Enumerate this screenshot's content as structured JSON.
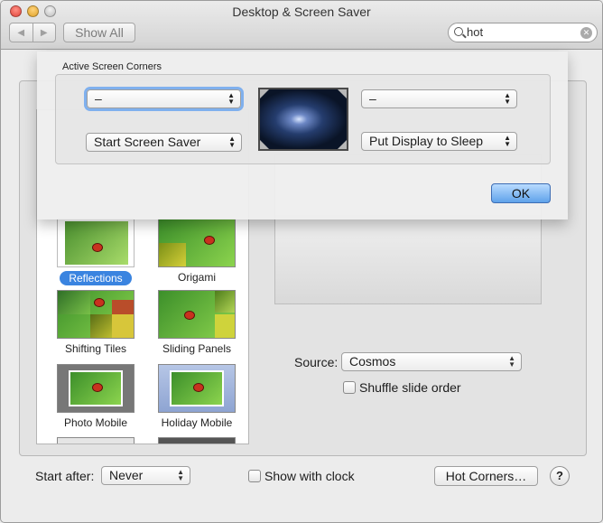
{
  "window": {
    "title": "Desktop & Screen Saver"
  },
  "toolbar": {
    "show_all_label": "Show All",
    "search_value": "hot",
    "back_icon": "chevron-left-icon",
    "forward_icon": "chevron-right-icon"
  },
  "sheet": {
    "title": "Active Screen Corners",
    "top_left": "–",
    "top_right": "–",
    "bottom_left": "Start Screen Saver",
    "bottom_right": "Put Display to Sleep",
    "ok_label": "OK"
  },
  "screensavers": {
    "items": [
      {
        "label": "Reflections",
        "selected": true
      },
      {
        "label": "Origami"
      },
      {
        "label": "Shifting Tiles"
      },
      {
        "label": "Sliding Panels"
      },
      {
        "label": "Photo Mobile"
      },
      {
        "label": "Holiday Mobile"
      }
    ]
  },
  "options": {
    "source_label": "Source:",
    "source_value": "Cosmos",
    "shuffle_label": "Shuffle slide order"
  },
  "bottom": {
    "start_after_label": "Start after:",
    "start_after_value": "Never",
    "show_clock_label": "Show with clock",
    "hot_corners_label": "Hot Corners…",
    "help_label": "?"
  },
  "colors": {
    "selection": "#3a84e0",
    "default_button": "#5fa2ea"
  }
}
